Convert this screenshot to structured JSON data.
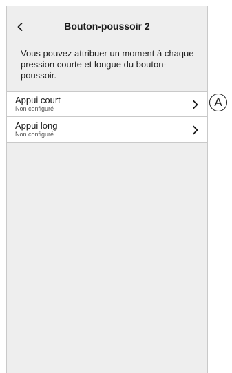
{
  "header": {
    "title": "Bouton-poussoir 2",
    "back_icon": "chevron-left-icon"
  },
  "description": "Vous pouvez attribuer un moment à chaque pression courte et longue du bouton-poussoir.",
  "list": {
    "items": [
      {
        "title": "Appui court",
        "subtitle": "Non configuré",
        "icon": "chevron-right-icon"
      },
      {
        "title": "Appui long",
        "subtitle": "Non configuré",
        "icon": "chevron-right-icon"
      }
    ]
  },
  "callout": {
    "label": "A"
  },
  "colors": {
    "background": "#eeeeee",
    "surface": "#ffffff",
    "divider": "#c9c9c9",
    "text": "#1a1a1a"
  }
}
